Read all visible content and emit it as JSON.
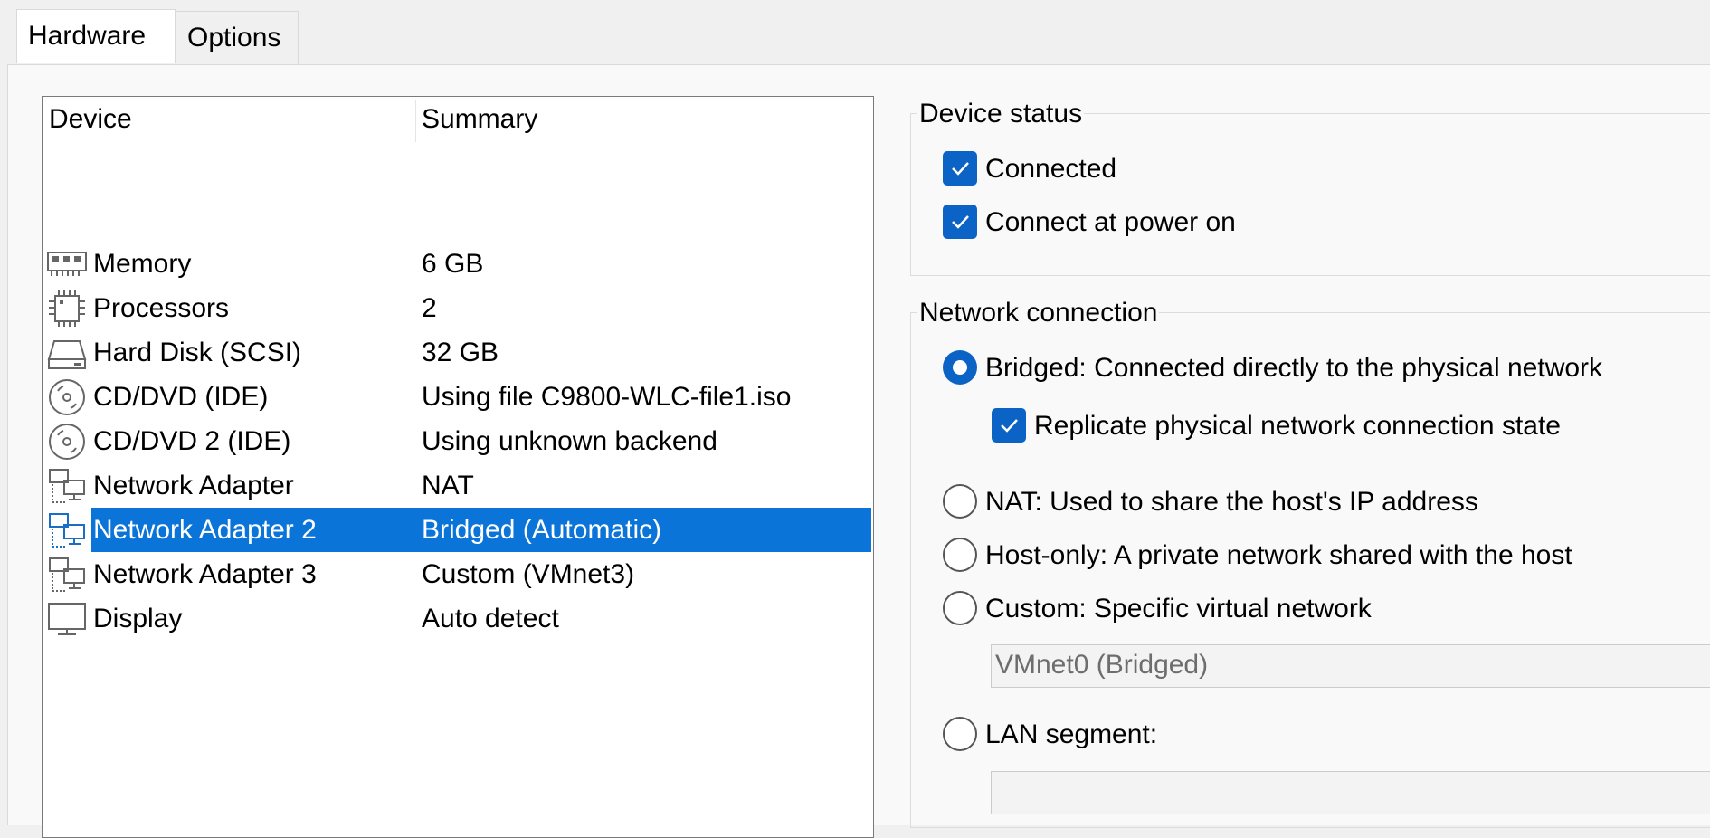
{
  "tabs": [
    {
      "label": "Hardware",
      "active": true
    },
    {
      "label": "Options",
      "active": false
    }
  ],
  "device_list": {
    "columns": [
      "Device",
      "Summary"
    ],
    "rows": [
      {
        "icon": "memory-icon",
        "device": "Memory",
        "summary": "6 GB"
      },
      {
        "icon": "processor-icon",
        "device": "Processors",
        "summary": "2"
      },
      {
        "icon": "hard-disk-icon",
        "device": "Hard Disk (SCSI)",
        "summary": "32 GB"
      },
      {
        "icon": "cd-dvd-icon",
        "device": "CD/DVD (IDE)",
        "summary": "Using file C9800-WLC-file1.iso"
      },
      {
        "icon": "cd-dvd-icon",
        "device": "CD/DVD 2 (IDE)",
        "summary": "Using unknown backend"
      },
      {
        "icon": "network-adapter-icon",
        "device": "Network Adapter",
        "summary": "NAT"
      },
      {
        "icon": "network-adapter-icon",
        "device": "Network Adapter 2",
        "summary": "Bridged (Automatic)",
        "selected": true
      },
      {
        "icon": "network-adapter-icon",
        "device": "Network Adapter 3",
        "summary": "Custom (VMnet3)"
      },
      {
        "icon": "display-icon",
        "device": "Display",
        "summary": "Auto detect"
      }
    ]
  },
  "device_status": {
    "title": "Device status",
    "connected": {
      "label": "Connected",
      "checked": true
    },
    "connect_at_power_on": {
      "label": "Connect at power on",
      "checked": true
    }
  },
  "network_connection": {
    "title": "Network connection",
    "bridged": {
      "label": "Bridged: Connected directly to the physical network",
      "checked": true
    },
    "replicate": {
      "label": "Replicate physical network connection state",
      "checked": true
    },
    "nat": {
      "label": "NAT: Used to share the host's IP address",
      "checked": false
    },
    "host_only": {
      "label": "Host-only: A private network shared with the host",
      "checked": false
    },
    "custom": {
      "label": "Custom: Specific virtual network",
      "checked": false
    },
    "custom_network_value": "VMnet0 (Bridged)",
    "lan_segment": {
      "label": "LAN segment:",
      "checked": false
    },
    "lan_segment_value": ""
  },
  "colors": {
    "accent": "#0b63c5",
    "selection": "#0a74d9"
  }
}
